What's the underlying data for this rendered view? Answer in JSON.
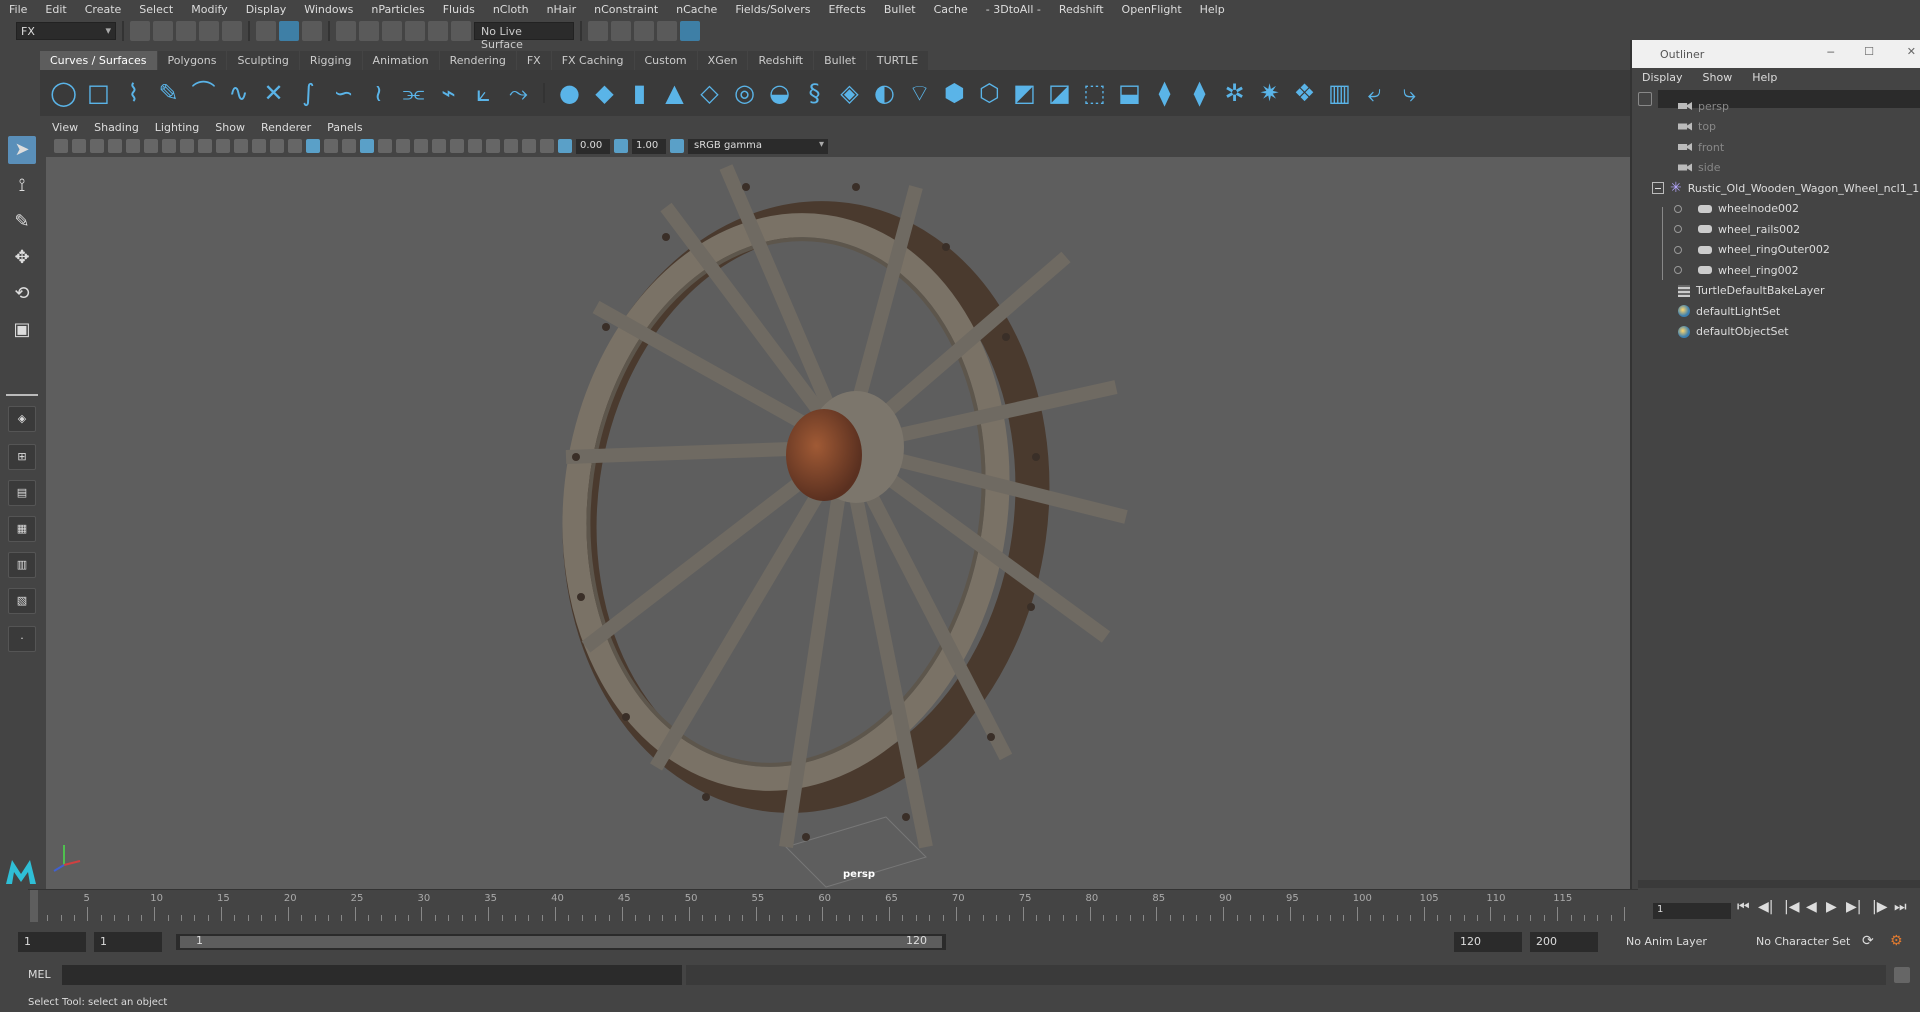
{
  "menu": [
    "File",
    "Edit",
    "Create",
    "Select",
    "Modify",
    "Display",
    "Windows",
    "nParticles",
    "Fluids",
    "nCloth",
    "nHair",
    "nConstraint",
    "nCache",
    "Fields/Solvers",
    "Effects",
    "Bullet",
    "Cache",
    "- 3DtoAll -",
    "Redshift",
    "OpenFlight",
    "Help"
  ],
  "status": {
    "mode": "FX",
    "live_surface": "No Live Surface"
  },
  "shelf_tabs": [
    "Curves / Surfaces",
    "Polygons",
    "Sculpting",
    "Rigging",
    "Animation",
    "Rendering",
    "FX",
    "FX Caching",
    "Custom",
    "XGen",
    "Redshift",
    "Bullet",
    "TURTLE"
  ],
  "shelf_active": "Curves / Surfaces",
  "panel_menu": [
    "View",
    "Shading",
    "Lighting",
    "Show",
    "Renderer",
    "Panels"
  ],
  "panel_tools": {
    "exposure": "0.00",
    "gamma": "1.00",
    "colorspace": "sRGB gamma"
  },
  "viewport": {
    "camera": "persp"
  },
  "outliner": {
    "title": "Outliner",
    "menu": [
      "Display",
      "Show",
      "Help"
    ],
    "items": [
      {
        "label": "persp",
        "icon": "camera-icon",
        "dim": true
      },
      {
        "label": "top",
        "icon": "camera-icon",
        "dim": true
      },
      {
        "label": "front",
        "icon": "camera-icon",
        "dim": true
      },
      {
        "label": "side",
        "icon": "camera-icon",
        "dim": true
      },
      {
        "label": "Rustic_Old_Wooden_Wagon_Wheel_ncl1_1",
        "icon": "group-icon",
        "dim": false
      },
      {
        "label": "wheelnode002",
        "icon": "mesh-icon",
        "dim": false
      },
      {
        "label": "wheel_rails002",
        "icon": "mesh-icon",
        "dim": false
      },
      {
        "label": "wheel_ringOuter002",
        "icon": "mesh-icon",
        "dim": false
      },
      {
        "label": "wheel_ring002",
        "icon": "mesh-icon",
        "dim": false
      },
      {
        "label": "TurtleDefaultBakeLayer",
        "icon": "layer-icon",
        "dim": false
      },
      {
        "label": "defaultLightSet",
        "icon": "set-icon",
        "dim": false
      },
      {
        "label": "defaultObjectSet",
        "icon": "set-icon",
        "dim": false
      }
    ]
  },
  "timeline": {
    "ticks": [
      "1",
      "5",
      "10",
      "15",
      "20",
      "25",
      "30",
      "35",
      "40",
      "45",
      "50",
      "55",
      "60",
      "65",
      "70",
      "75",
      "80",
      "85",
      "90",
      "95",
      "100",
      "105",
      "110",
      "115"
    ],
    "current_frame": "1"
  },
  "range": {
    "start": "1",
    "playback_start": "1",
    "slider_start": "1",
    "slider_end": "120",
    "playback_end": "120",
    "end": "200",
    "anim_layer": "No Anim Layer",
    "character_set": "No Character Set"
  },
  "command": {
    "lang": "MEL"
  },
  "help_text": "Select Tool: select an object",
  "colors": {
    "accent": "#5ab4e8",
    "active_tab": "#5d5d5d",
    "background": "#444444",
    "viewport": "#5e5e5e"
  }
}
